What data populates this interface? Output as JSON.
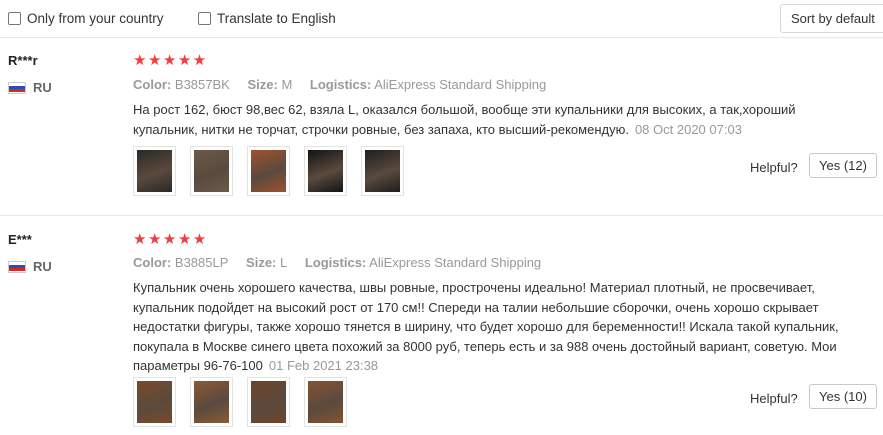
{
  "filters": {
    "only_country_label": "Only from your country",
    "translate_label": "Translate to English",
    "sort_label": "Sort by default"
  },
  "reviews": [
    {
      "user": "R***r",
      "country": "RU",
      "rating": "★★★★★",
      "color_label": "Color:",
      "color_value": "B3857BK",
      "size_label": "Size:",
      "size_value": "M",
      "logistics_label": "Logistics:",
      "logistics_value": "AliExpress Standard Shipping",
      "text": "На рост 162, бюст 98,вес 62, взяла L, оказался большой, вообще эти купальники для высоких, а так,хороший купальник, нитки не торчат, строчки ровные, без запаха, кто высший-рекомендую.",
      "date": "08 Oct 2020 07:03",
      "photos": [
        "photo-1",
        "photo-2",
        "photo-3",
        "photo-4",
        "photo-5"
      ],
      "photo_colors": [
        "#2a2826",
        "#6b5a4a",
        "#a0522d",
        "#141414",
        "#1e1e1e"
      ],
      "helpful_label": "Helpful?",
      "yes_label": "Yes (12)"
    },
    {
      "user": "E***",
      "country": "RU",
      "rating": "★★★★★",
      "color_label": "Color:",
      "color_value": "B3885LP",
      "size_label": "Size:",
      "size_value": "L",
      "logistics_label": "Logistics:",
      "logistics_value": "AliExpress Standard Shipping",
      "text": "Купальник очень хорошего качества, швы ровные, прострочены идеально! Материал плотный, не просвечивает, купальник подойдет на высокий рост от 170 см!! Спереди на талии небольшие сборочки, очень хорошо скрывает недостатки фигуры, также хорошо тянется в ширину, что будет хорошо для беременности!! Искала такой купальник, покупала в Москве синего цвета похожий за 8000 руб, теперь есть и за 988 очень достойный вариант, советую. Мои параметры 96-76-100",
      "date": "01 Feb 2021 23:38",
      "photos": [
        "photo-1",
        "photo-2",
        "photo-3",
        "photo-4"
      ],
      "photo_colors": [
        "#7a4a2a",
        "#8a5a35",
        "#6e4428",
        "#855332"
      ],
      "helpful_label": "Helpful?",
      "yes_label": "Yes (10)"
    }
  ]
}
